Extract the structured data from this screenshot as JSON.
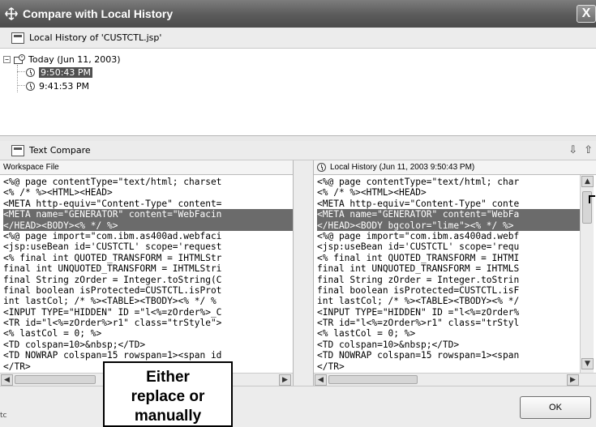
{
  "window": {
    "title": "Compare with Local History",
    "close_label": "X"
  },
  "history": {
    "header": "Local History of 'CUSTCTL.jsp'",
    "group_label": "Today (Jun 11, 2003)",
    "group_expander": "−",
    "entries": [
      "9:50:43 PM",
      "9:41:53 PM"
    ]
  },
  "compare": {
    "header": "Text Compare",
    "nav_down": "⇩",
    "nav_up": "⇧",
    "left_label": "Workspace File",
    "right_label": "Local History (Jun 11, 2003 9:50:43 PM)",
    "left_lines": [
      "<%@ page contentType=\"text/html; charset",
      "<% /* %><HTML><HEAD>",
      "<META http-equiv=\"Content-Type\" content=",
      "<META name=\"GENERATOR\" content=\"WebFacin",
      "</HEAD><BODY><% */ %>",
      "<%@ page import=\"com.ibm.as400ad.webfaci",
      "<jsp:useBean id='CUSTCTL' scope='request",
      "<% final int QUOTED_TRANSFORM = IHTMLStr",
      "final int UNQUOTED_TRANSFORM = IHTMLStri",
      "final String zOrder = Integer.toString(C",
      "final boolean isProtected=CUSTCTL.isProt",
      "int lastCol; /* %><TABLE><TBODY><% */ %",
      "<INPUT TYPE=\"HIDDEN\" ID =\"l<%=zOrder%>_C",
      "<TR id=\"l<%=zOrder%>r1\" class=\"trStyle\">",
      "<% lastCol = 0; %>",
      "<TD colspan=10>&nbsp;</TD>",
      "<TD NOWRAP colspan=15 rowspan=1><span id",
      "</TR>"
    ],
    "right_lines": [
      "<%@ page contentType=\"text/html; char",
      "<% /* %><HTML><HEAD>",
      "<META http-equiv=\"Content-Type\" conte",
      "<META name=\"GENERATOR\" content=\"WebFa",
      "</HEAD><BODY bgcolor=\"lime\"><% */ %>",
      "<%@ page import=\"com.ibm.as400ad.webf",
      "<jsp:useBean id='CUSTCTL' scope='requ",
      "<% final int QUOTED_TRANSFORM = IHTMI",
      "final int UNQUOTED_TRANSFORM = IHTMLS",
      "final String zOrder = Integer.toStrin",
      "final boolean isProtected=CUSTCTL.isF",
      "int lastCol; /* %><TABLE><TBODY><% */",
      "<INPUT TYPE=\"HIDDEN\" ID =\"l<%=zOrder%",
      "<TR id=\"l<%=zOrder%>r1\" class=\"trStyl",
      "<% lastCol = 0; %>",
      "<TD colspan=10>&nbsp;</TD>",
      "<TD NOWRAP colspan=15 rowspan=1><span",
      "</TR>"
    ],
    "highlight_lines": [
      3,
      4
    ]
  },
  "footer": {
    "ok_label": "OK",
    "left_edge_text": "tc"
  },
  "callout": {
    "lines": [
      "Either",
      "replace or",
      "manually"
    ]
  },
  "colors": {
    "titlebar": "#5d5d5d",
    "highlight": "#6b6b6b"
  }
}
